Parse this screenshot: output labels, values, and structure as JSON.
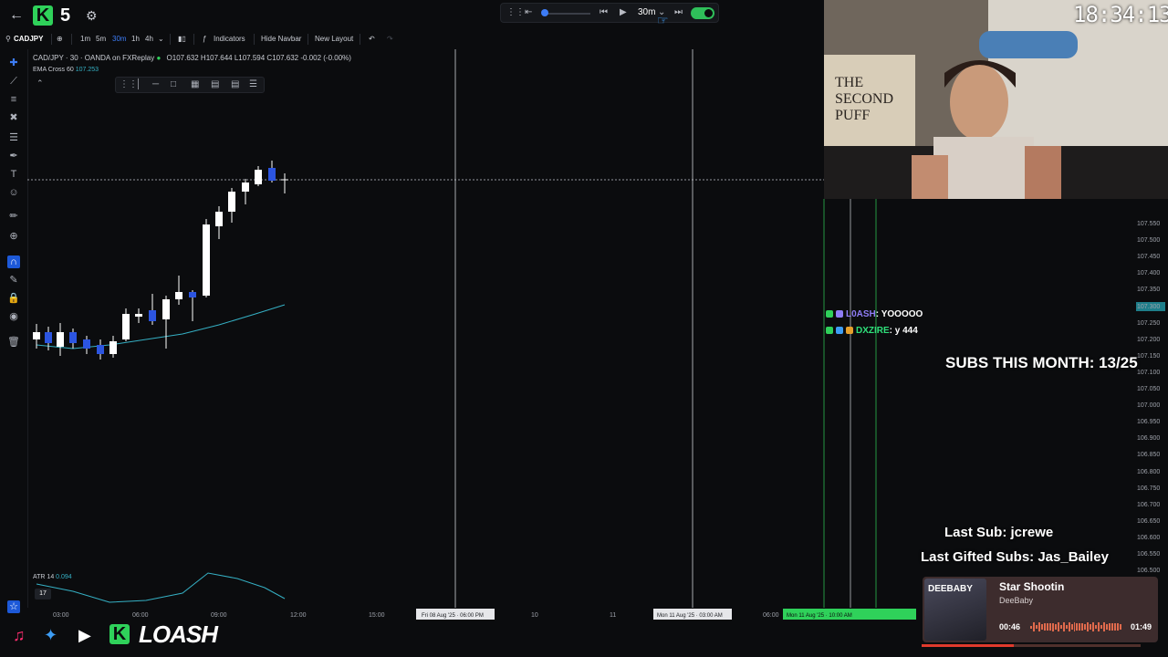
{
  "topbar": {
    "back_icon": "arrow-left-icon",
    "logo_letter": "K",
    "logo_number": "5",
    "settings_icon": "gear-icon"
  },
  "replay": {
    "interval": "30m",
    "toggle_on": true
  },
  "toolbar": {
    "symbol": "CADJPY",
    "intervals": [
      "1m",
      "5m",
      "30m",
      "1h",
      "4h"
    ],
    "active_interval": "30m",
    "indicators": "Indicators",
    "hide_navbar": "Hide Navbar",
    "new_layout": "New Layout"
  },
  "legend": {
    "symbol_line": "CAD/JPY · 30 · OANDA on FXReplay",
    "ohlc": "O107.632 H107.644 L107.594 C107.632 -0.002 (-0.00%)",
    "ema_label": "EMA Cross 60",
    "ema_value": "107.253"
  },
  "atr": {
    "label": "ATR 14",
    "value": "0.094"
  },
  "price_axis": [
    "107.550",
    "107.500",
    "107.450",
    "107.400",
    "107.350",
    "107.300",
    "107.250",
    "107.200",
    "107.150",
    "107.100",
    "107.050",
    "107.000",
    "106.950",
    "106.900",
    "106.850",
    "106.800",
    "106.750",
    "106.700",
    "106.650",
    "106.600",
    "106.550",
    "106.500"
  ],
  "time_axis": [
    {
      "label": "03:00",
      "x": 0.0
    },
    {
      "label": "06:00",
      "x": 0.0
    },
    {
      "label": "09:00",
      "x": 0.0
    },
    {
      "label": "12:00",
      "x": 0.0
    },
    {
      "label": "15:00",
      "x": 0.0
    },
    {
      "label": "Fri 08 Aug '25 · 06:00 PM",
      "x": 0.0
    },
    {
      "label": "10",
      "x": 0.0
    },
    {
      "label": "11",
      "x": 0.0
    },
    {
      "label": "Mon 11 Aug '25 · 03:00 AM",
      "x": 0.0
    },
    {
      "label": "06:00",
      "x": 0.0
    },
    {
      "label": "Mon 11 Aug '25 · 10:00 AM",
      "x": 0.0
    }
  ],
  "overlay": {
    "clock": "18:34:13",
    "chat": [
      {
        "user": "L0ASH",
        "message": ": YOOOOO"
      },
      {
        "user": "DXZIRE",
        "message": ": y 444"
      }
    ],
    "subs_month": "SUBS THIS MONTH: 13/25",
    "last_sub": "Last Sub: jcrewe",
    "last_gifted": "Last Gifted Subs: Jas_Bailey"
  },
  "music": {
    "album_text": "DEEBABY",
    "title": "Star Shootin",
    "artist": "DeeBaby",
    "elapsed": "00:46",
    "duration": "01:49",
    "progress": 0.42
  },
  "branding": {
    "letter": "K",
    "name": "LOASH"
  },
  "colors": {
    "accent_blue": "#1d59d8",
    "green": "#2fd15a",
    "ema": "#35b0c4"
  }
}
